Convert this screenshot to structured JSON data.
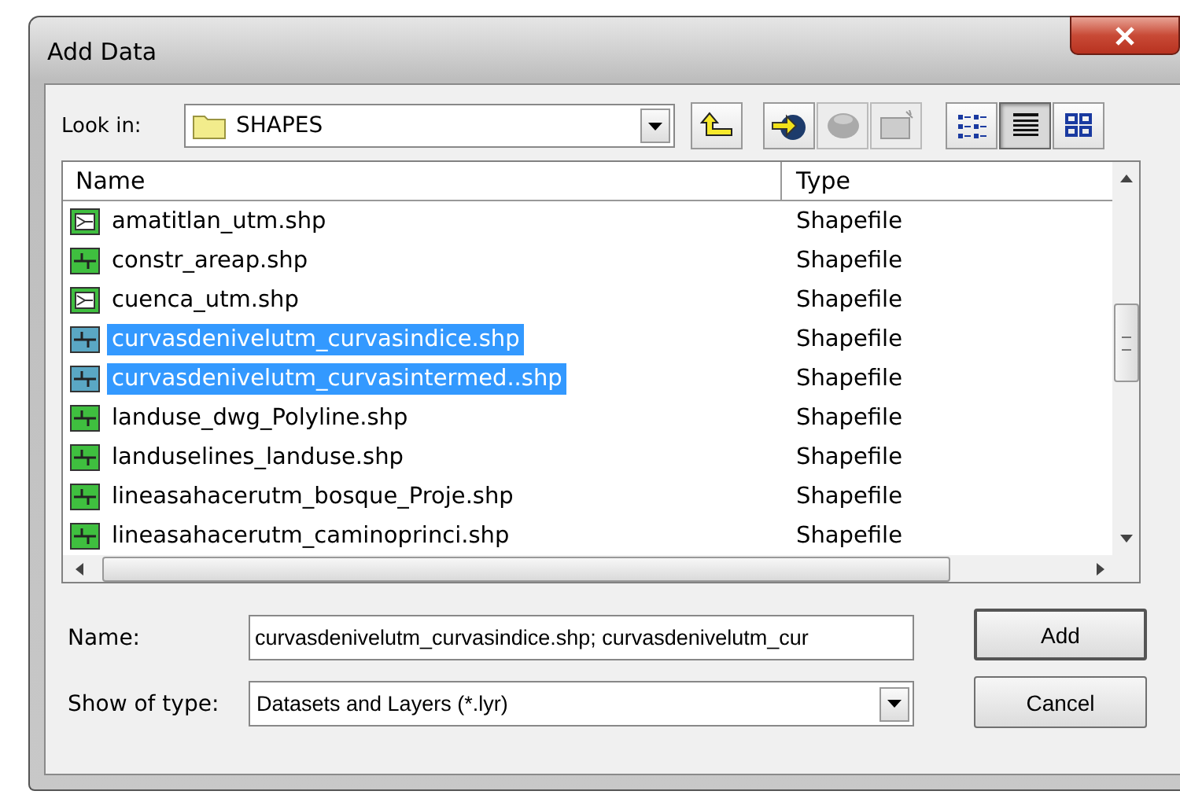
{
  "window": {
    "title": "Add Data"
  },
  "look_in": {
    "label": "Look in:",
    "value": "SHAPES"
  },
  "tools": [
    {
      "kind": "up",
      "disabled": false
    },
    {
      "kind": "connect",
      "disabled": false
    },
    {
      "kind": "database",
      "disabled": true
    },
    {
      "kind": "catalog",
      "disabled": true
    }
  ],
  "views": [
    {
      "kind": "list",
      "selected": false
    },
    {
      "kind": "details",
      "selected": true
    },
    {
      "kind": "thumbnails",
      "selected": false
    }
  ],
  "table": {
    "columns": [
      "Name",
      "Type"
    ],
    "rows": [
      {
        "name": "amatitlan_utm.shp",
        "type": "Shapefile",
        "kind": "polygon",
        "selected": false
      },
      {
        "name": "constr_areap.shp",
        "type": "Shapefile",
        "kind": "line",
        "selected": false
      },
      {
        "name": "cuenca_utm.shp",
        "type": "Shapefile",
        "kind": "polygon",
        "selected": false
      },
      {
        "name": "curvasdenivelutm_curvasindice.shp",
        "type": "Shapefile",
        "kind": "line",
        "selected": true
      },
      {
        "name": "curvasdenivelutm_curvasintermed..shp",
        "type": "Shapefile",
        "kind": "line",
        "selected": true
      },
      {
        "name": "landuse_dwg_Polyline.shp",
        "type": "Shapefile",
        "kind": "line",
        "selected": false
      },
      {
        "name": "landuselines_landuse.shp",
        "type": "Shapefile",
        "kind": "line",
        "selected": false
      },
      {
        "name": "lineasahacerutm_bosque_Proje.shp",
        "type": "Shapefile",
        "kind": "line",
        "selected": false
      },
      {
        "name": "lineasahacerutm_caminoprinci.shp",
        "type": "Shapefile",
        "kind": "line",
        "selected": false
      }
    ]
  },
  "name_field": {
    "label": "Name:",
    "value": "curvasdenivelutm_curvasindice.shp; curvasdenivelutm_cur"
  },
  "type_field": {
    "label": "Show of type:",
    "value": "Datasets and Layers (*.lyr)"
  },
  "buttons": [
    "Add",
    "Cancel"
  ]
}
